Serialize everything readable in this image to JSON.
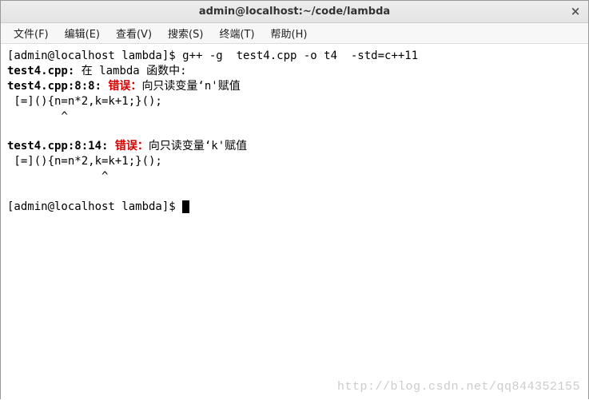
{
  "window": {
    "title": "admin@localhost:~/code/lambda",
    "close_glyph": "×"
  },
  "menubar": {
    "items": [
      {
        "label": "文件(F)"
      },
      {
        "label": "编辑(E)"
      },
      {
        "label": "查看(V)"
      },
      {
        "label": "搜索(S)"
      },
      {
        "label": "终端(T)"
      },
      {
        "label": "帮助(H)"
      }
    ]
  },
  "terminal": {
    "prompt1_left": "[admin@localhost lambda]$ ",
    "cmd": "g++ -g  test4.cpp -o t4  -std=c++11",
    "line2_bold": "test4.cpp:",
    "line2_rest": " 在 lambda 函数中:",
    "line3_loc": "test4.cpp:8:8: ",
    "line3_err": "错误：",
    "line3_msg": "向只读变量‘n'赋值",
    "line4_code": " [=](){n=n*2,k=k+1;}();",
    "line5_caret": "        ^",
    "line6_loc": "test4.cpp:8:14: ",
    "line6_err": "错误：",
    "line6_msg": "向只读变量‘k'赋值",
    "line7_code": " [=](){n=n*2,k=k+1;}();",
    "line8_caret": "              ^",
    "prompt2_left": "[admin@localhost lambda]$ "
  },
  "watermark": "http://blog.csdn.net/qq844352155"
}
